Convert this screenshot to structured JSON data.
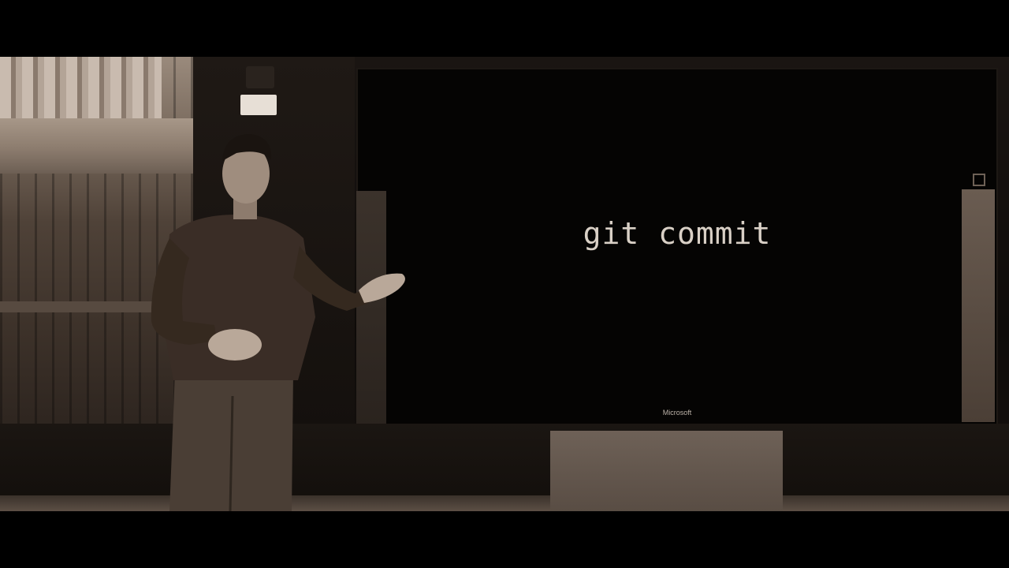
{
  "slide": {
    "text": "git commit",
    "brand": "Microsoft"
  },
  "colors": {
    "slide_background": "#050403",
    "slide_text": "#d9d0c6",
    "letterbox": "#000000",
    "tint": "sepia"
  }
}
